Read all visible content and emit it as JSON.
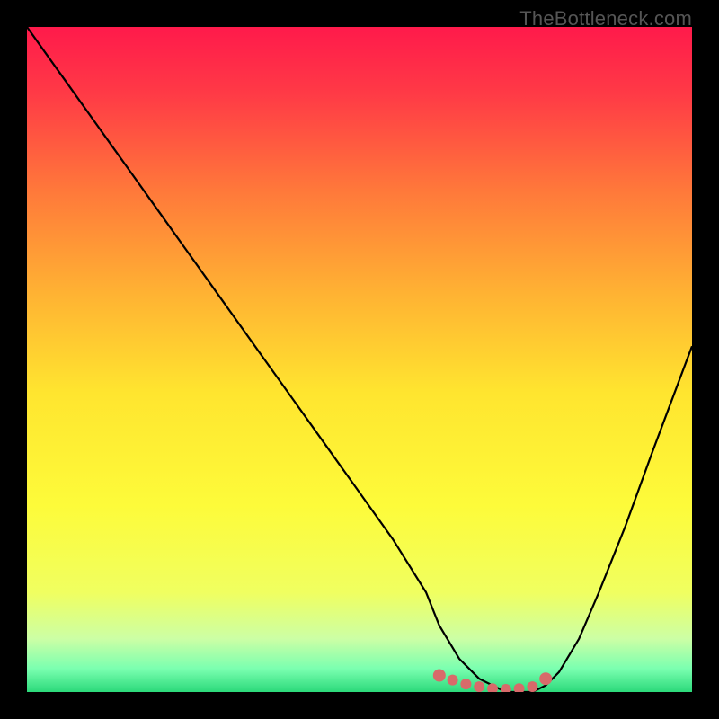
{
  "watermark": "TheBottleneck.com",
  "chart_data": {
    "type": "line",
    "title": "",
    "xlabel": "",
    "ylabel": "",
    "xlim": [
      0,
      100
    ],
    "ylim": [
      0,
      100
    ],
    "series": [
      {
        "name": "bottleneck-curve",
        "x": [
          0,
          5,
          10,
          15,
          20,
          25,
          30,
          35,
          40,
          45,
          50,
          55,
          60,
          62,
          65,
          68,
          70,
          72,
          74,
          76,
          78,
          80,
          83,
          86,
          90,
          94,
          97,
          100
        ],
        "y": [
          100,
          93,
          86,
          79,
          72,
          65,
          58,
          51,
          44,
          37,
          30,
          23,
          15,
          10,
          5,
          2,
          1,
          0,
          0,
          0,
          1,
          3,
          8,
          15,
          25,
          36,
          44,
          52
        ]
      }
    ],
    "highlight_dots": {
      "name": "optimal-range",
      "color": "#d86a6a",
      "x": [
        62,
        64,
        66,
        68,
        70,
        72,
        74,
        76,
        78
      ],
      "y": [
        2.5,
        1.8,
        1.2,
        0.8,
        0.5,
        0.4,
        0.5,
        0.8,
        2.0
      ]
    },
    "gradient_stops": [
      {
        "pos": 0.0,
        "color": "#ff1a4b"
      },
      {
        "pos": 0.1,
        "color": "#ff3a46"
      },
      {
        "pos": 0.25,
        "color": "#ff7a3a"
      },
      {
        "pos": 0.4,
        "color": "#ffb233"
      },
      {
        "pos": 0.55,
        "color": "#ffe52f"
      },
      {
        "pos": 0.72,
        "color": "#fdfb3a"
      },
      {
        "pos": 0.85,
        "color": "#f0ff60"
      },
      {
        "pos": 0.92,
        "color": "#ccffa5"
      },
      {
        "pos": 0.965,
        "color": "#7affb0"
      },
      {
        "pos": 1.0,
        "color": "#2bd97a"
      }
    ]
  }
}
